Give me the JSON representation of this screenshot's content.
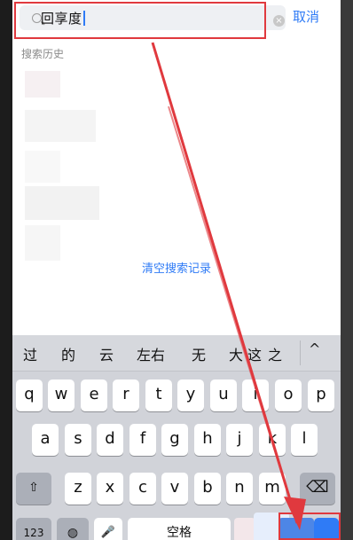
{
  "search": {
    "query": "回享度",
    "clear_icon": "×",
    "cancel_label": "取消"
  },
  "history": {
    "title": "搜索历史",
    "clear_label": "清空搜索记录"
  },
  "keyboard": {
    "candidates": [
      "过",
      "的",
      "云",
      "左右",
      "无",
      "大",
      "这",
      "之"
    ],
    "collapse_icon": "^",
    "row1": [
      "q",
      "w",
      "e",
      "r",
      "t",
      "y",
      "u",
      "i",
      "o",
      "p"
    ],
    "row2": [
      "a",
      "s",
      "d",
      "f",
      "g",
      "h",
      "j",
      "k",
      "l"
    ],
    "row3": [
      "z",
      "x",
      "c",
      "v",
      "b",
      "n",
      "m"
    ],
    "shift_icon": "⇧",
    "delete_icon": "⌫",
    "numbers_label": "123",
    "globe_icon": "◍",
    "mic_icon": "🎤",
    "space_label": "空格"
  },
  "colors": {
    "accent": "#2f7bf6",
    "annotation_red": "#e0393e"
  }
}
